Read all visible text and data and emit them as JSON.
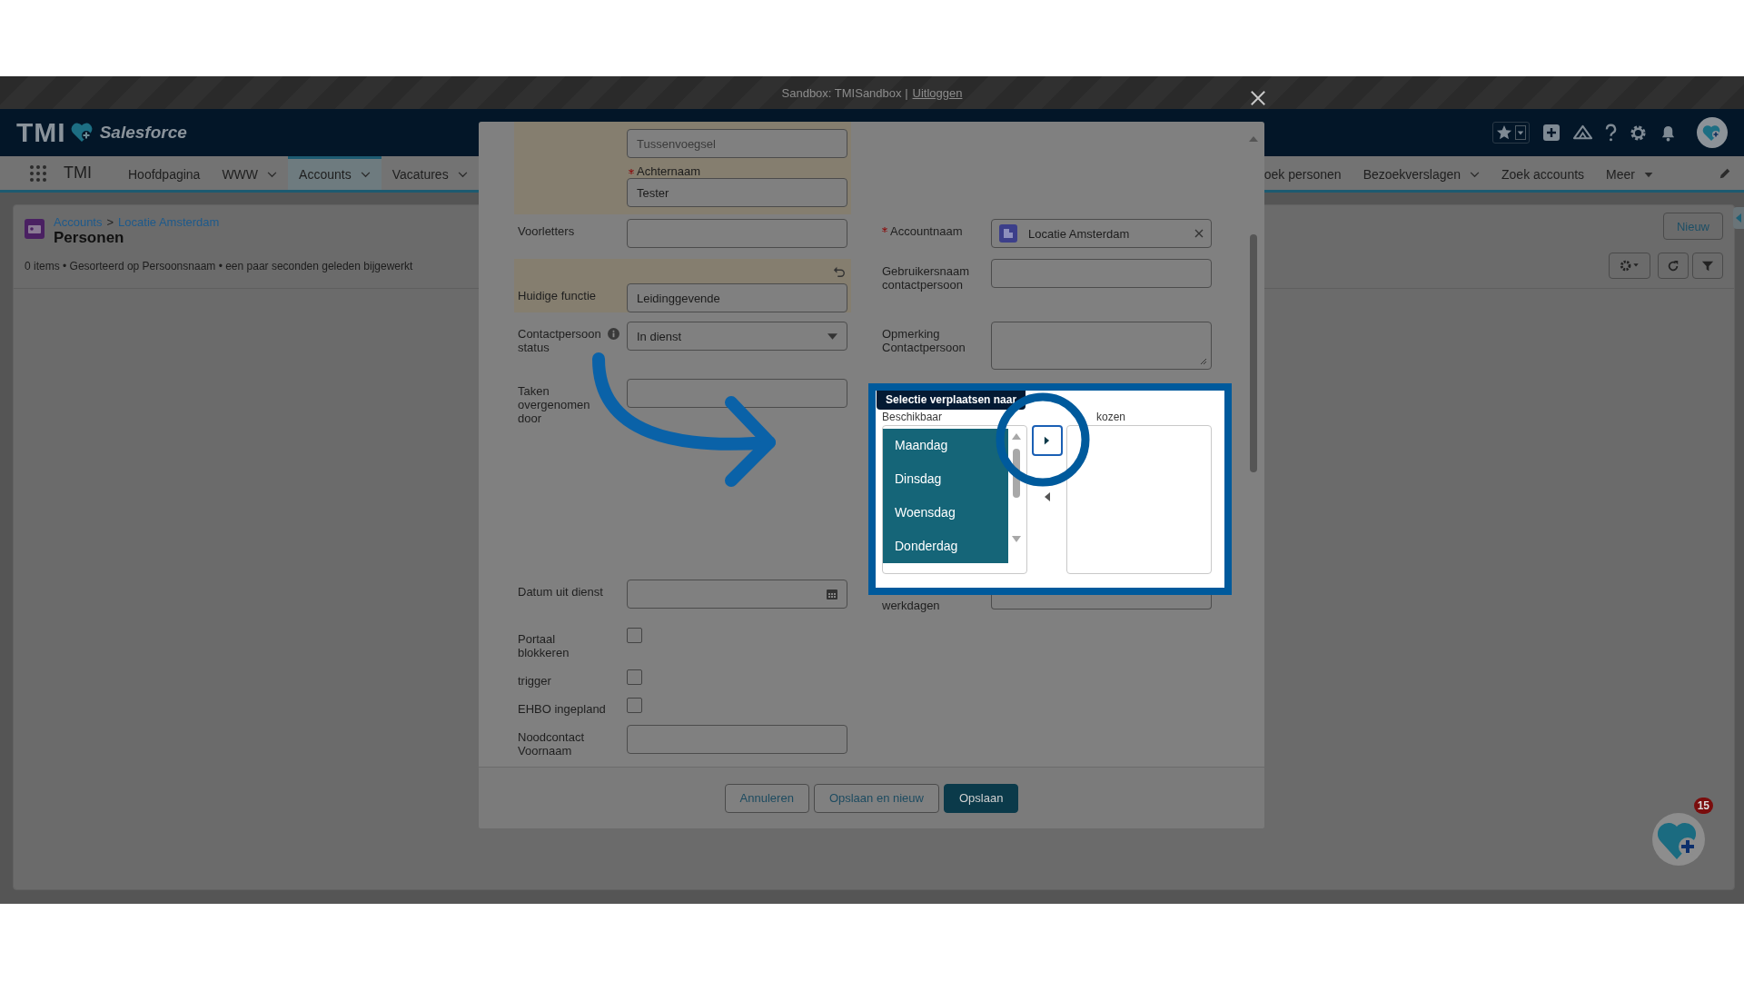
{
  "top_bar": {
    "sandbox": "Sandbox: TMISandbox |",
    "logout": "Uitloggen"
  },
  "header": {
    "logo": "TMI",
    "brand": "Salesforce"
  },
  "nav": {
    "app_name": "TMI",
    "items": [
      {
        "label": "Hoofdpagina",
        "selected": false,
        "kind": "plain"
      },
      {
        "label": "WWW",
        "selected": false,
        "kind": "dropdown"
      },
      {
        "label": "Accounts",
        "selected": true,
        "kind": "dropdown"
      },
      {
        "label": "Vacatures",
        "selected": false,
        "kind": "dropdown"
      }
    ],
    "items_right": [
      {
        "label": "oek personen",
        "selected": false,
        "kind": "plain"
      },
      {
        "label": "Bezoekverslagen",
        "selected": false,
        "kind": "dropdown"
      },
      {
        "label": "Zoek accounts",
        "selected": false,
        "kind": "plain"
      },
      {
        "label": "Meer",
        "selected": false,
        "kind": "more"
      }
    ]
  },
  "page": {
    "breadcrumb": [
      "Accounts",
      "Locatie Amsterdam"
    ],
    "separator": ">",
    "title": "Personen",
    "summary": "0 items • Gesorteerd op Persoonsnaam • een paar seconden geleden bijgewerkt",
    "new_button": "Nieuw"
  },
  "modal": {
    "rows": [
      {
        "left": {
          "kind": "group",
          "highlighted": true,
          "fields": [
            {
              "placeholder": "Tussenvoegsel"
            },
            {
              "label": "Achternaam",
              "required": true,
              "value": "Tester"
            }
          ]
        }
      },
      {
        "left": {
          "kind": "text",
          "label": "Voorletters"
        },
        "right": {
          "kind": "lookup",
          "label": "Accountnaam",
          "required": true,
          "value": "Locatie Amsterdam"
        }
      },
      {
        "left": {
          "kind": "text",
          "label": "Huidige functie",
          "value": "Leidinggevende",
          "highlighted": true,
          "changed": true
        },
        "right": {
          "kind": "text",
          "label": "Gebruikersnaam contactpersoon"
        }
      },
      {
        "left": {
          "kind": "select",
          "label": "Contactpersoon status",
          "value": "In dienst",
          "info": true
        },
        "right": {
          "kind": "textarea",
          "label": "Opmerking Contactpersoon"
        }
      },
      {
        "left": {
          "kind": "text",
          "label": "Taken overgenomen door"
        },
        "right": {
          "kind": "dueling",
          "tooltip": "Selectie verplaatsen naar",
          "available_label": "Beschikbaar",
          "chosen_label": "kozen",
          "options": [
            {
              "label": "Maandag",
              "selected": true
            },
            {
              "label": "Dinsdag",
              "selected": true
            },
            {
              "label": "Woensdag",
              "selected": true
            },
            {
              "label": "Donderdag",
              "selected": true
            }
          ]
        }
      },
      {
        "left": {
          "kind": "date",
          "label": "Datum uit dienst"
        },
        "right": {
          "kind": "text",
          "label": "werkdagen"
        }
      },
      {
        "left": {
          "kind": "checkbox",
          "label": "Portaal blokkeren",
          "checked": false
        }
      },
      {
        "left": {
          "kind": "checkbox",
          "label": "trigger",
          "checked": false
        }
      },
      {
        "left": {
          "kind": "checkbox",
          "label": "EHBO ingepland",
          "checked": false
        }
      },
      {
        "left": {
          "kind": "text",
          "label": "Noodcontact Voornaam"
        }
      }
    ],
    "buttons": [
      {
        "label": "Annuleren",
        "kind": "neutral"
      },
      {
        "label": "Opslaan en nieuw",
        "kind": "neutral"
      },
      {
        "label": "Opslaan",
        "kind": "brand"
      }
    ]
  },
  "notifications": {
    "count": "15"
  }
}
